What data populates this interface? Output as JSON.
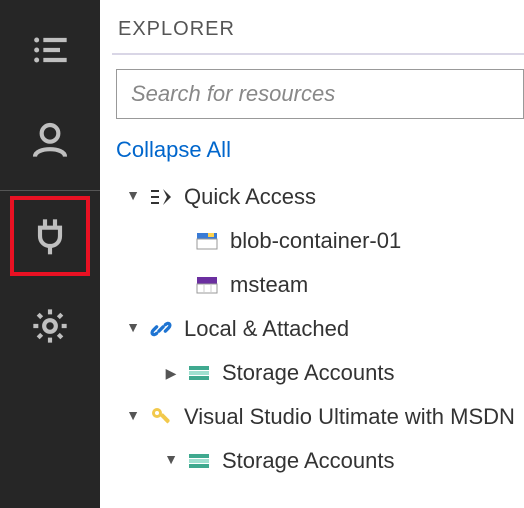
{
  "activitybar": {
    "items": [
      {
        "name": "explorer-icon"
      },
      {
        "name": "account-icon"
      },
      {
        "name": "plug-icon"
      },
      {
        "name": "settings-icon"
      }
    ],
    "highlighted": "plug-icon"
  },
  "explorer": {
    "title": "EXPLORER",
    "search": {
      "placeholder": "Search for resources"
    },
    "collapse_label": "Collapse All",
    "tree": [
      {
        "label": "Quick Access",
        "icon": "quick-access-icon",
        "expanded": true,
        "depth": 0,
        "children": [
          {
            "label": "blob-container-01",
            "icon": "blob-container-icon",
            "depth": 1
          },
          {
            "label": "msteam",
            "icon": "table-icon",
            "depth": 1
          }
        ]
      },
      {
        "label": "Local & Attached",
        "icon": "link-icon",
        "expanded": true,
        "depth": 0,
        "children": [
          {
            "label": "Storage Accounts",
            "icon": "storage-icon",
            "expanded": false,
            "depth": 1
          }
        ]
      },
      {
        "label": "Visual Studio Ultimate with MSDN",
        "icon": "key-icon",
        "expanded": true,
        "depth": 0,
        "children": [
          {
            "label": "Storage Accounts",
            "icon": "storage-icon",
            "expanded": true,
            "depth": 1
          }
        ]
      }
    ]
  }
}
